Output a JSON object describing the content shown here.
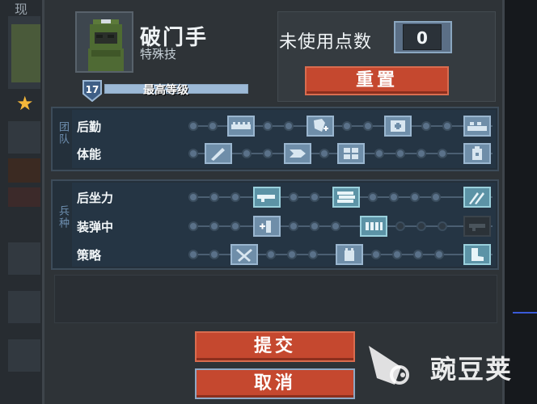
{
  "background": {
    "strip_title": "现"
  },
  "character": {
    "name": "破门手",
    "subtitle": "特殊技",
    "level": "17",
    "level_status": "最高等级",
    "level_progress": 1.0
  },
  "points": {
    "label": "未使用点数",
    "value": "0"
  },
  "buttons": {
    "reset": "重置",
    "submit": "提交",
    "cancel": "取消"
  },
  "groups": {
    "team": {
      "label": "团队",
      "rows": [
        {
          "label": "后勤"
        },
        {
          "label": "体能"
        }
      ]
    },
    "class": {
      "label": "兵种",
      "rows": [
        {
          "label": "后坐力"
        },
        {
          "label": "装弹中"
        },
        {
          "label": "策略"
        }
      ]
    }
  },
  "colors": {
    "accent": "#c5482f",
    "panel": "#2e3337",
    "skill_icon": "#6f8ea9",
    "star": "#f4b73a"
  },
  "watermark": "豌豆荚"
}
